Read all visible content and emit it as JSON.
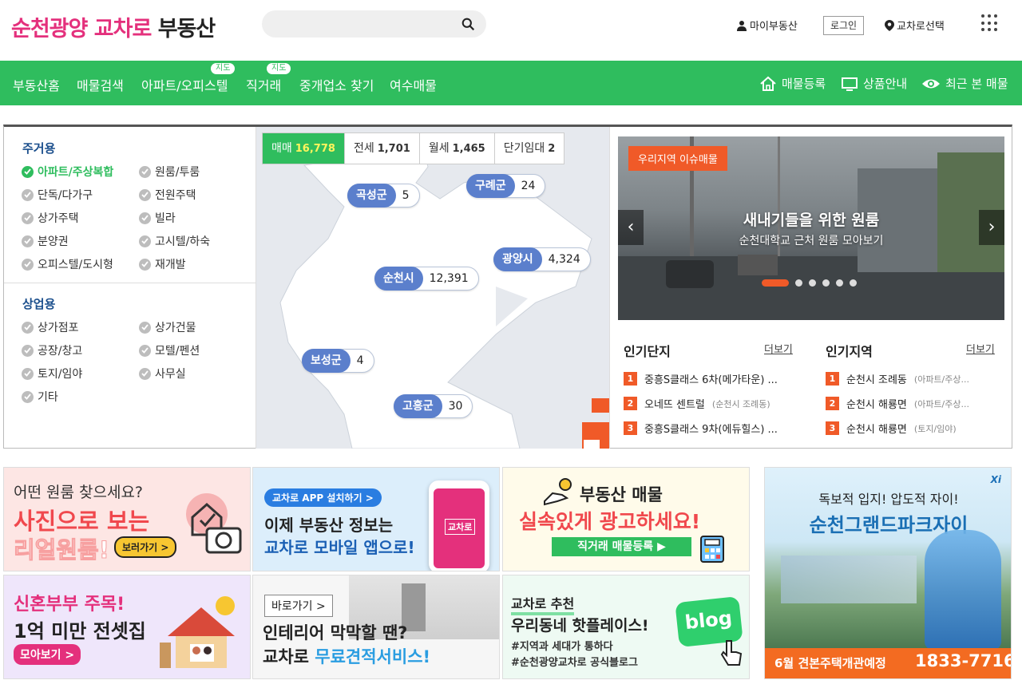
{
  "header": {
    "logo_part1": "순천광양 교차로",
    "logo_part2": "부동산",
    "search_placeholder": "",
    "my_realty": "마이부동산",
    "login": "로그인",
    "region_select": "교차로선택"
  },
  "nav": {
    "items": [
      {
        "label": "부동산홈"
      },
      {
        "label": "매물검색"
      },
      {
        "label": "아파트/오피스텔",
        "badge": "지도"
      },
      {
        "label": "직거래",
        "badge": "지도"
      },
      {
        "label": "중개업소 찾기"
      },
      {
        "label": "여수매물"
      }
    ],
    "right": {
      "register": "매물등록",
      "products": "상품안내",
      "recent": "최근 본 매물"
    }
  },
  "categories": {
    "residential_title": "주거용",
    "residential": [
      "아파트/주상복합",
      "원룸/투룸",
      "단독/다가구",
      "전원주택",
      "상가주택",
      "빌라",
      "분양권",
      "고시텔/하숙",
      "오피스텔/도시형",
      "재개발"
    ],
    "commercial_title": "상업용",
    "commercial": [
      "상가점포",
      "상가건물",
      "공장/창고",
      "모텔/펜션",
      "토지/임야",
      "사무실",
      "기타"
    ]
  },
  "map": {
    "tabs": [
      {
        "label": "매매",
        "count": "16,778"
      },
      {
        "label": "전세",
        "count": "1,701"
      },
      {
        "label": "월세",
        "count": "1,465"
      },
      {
        "label": "단기임대",
        "count": "2"
      }
    ],
    "regions": [
      {
        "name": "곡성군",
        "count": "5"
      },
      {
        "name": "구례군",
        "count": "24"
      },
      {
        "name": "광양시",
        "count": "4,324"
      },
      {
        "name": "순천시",
        "count": "12,391"
      },
      {
        "name": "보성군",
        "count": "4"
      },
      {
        "name": "고흥군",
        "count": "30"
      }
    ]
  },
  "slider": {
    "tag": "우리지역 이슈매물",
    "title": "새내기들을 위한 원룸",
    "subtitle": "순천대학교 근처 원룸 모아보기"
  },
  "popular_complex": {
    "title": "인기단지",
    "more": "더보기",
    "items": [
      {
        "rank": "1",
        "name": "중흥S클래스 6차(메가타운) ...",
        "sub": ""
      },
      {
        "rank": "2",
        "name": "오네뜨 센트럴",
        "sub": "(순천시 조례동)"
      },
      {
        "rank": "3",
        "name": "중흥S클래스 9차(에듀힐스) ...",
        "sub": ""
      }
    ]
  },
  "popular_region": {
    "title": "인기지역",
    "more": "더보기",
    "items": [
      {
        "rank": "1",
        "name": "순천시 조례동",
        "sub": "(아파트/주상..."
      },
      {
        "rank": "2",
        "name": "순천시 해룡면",
        "sub": "(아파트/주상..."
      },
      {
        "rank": "3",
        "name": "순천시 해룡면",
        "sub": "(토지/임야)"
      }
    ]
  },
  "banners": {
    "b1": {
      "line1": "어떤 원룸 찾으세요?",
      "line2": "사진으로 보는",
      "line3": "리얼원룸!",
      "btn": "보러가기 >"
    },
    "b2": {
      "pill": "교차로 APP 설치하기 >",
      "line1": "이제 부동산 정보는",
      "line2": "교차로 모바일 앱으로!",
      "app": "교차로"
    },
    "b3": {
      "line1": "부동산 매물",
      "line2": "실속있게 광고하세요!",
      "btn": "직거래 매물등록 ▶"
    },
    "b4": {
      "line1": "독보적 입지! 압도적 자이!",
      "line2": "순천그랜드파크자이",
      "footer1": "6월 견본주택개관예정",
      "footer2": "1833-7716",
      "brand": "Xi"
    },
    "b5": {
      "line1": "신혼부부 주목!",
      "line2": "1억 미만 전셋집",
      "btn": "모아보기 >"
    },
    "b6": {
      "pill": "바로가기 >",
      "line1": "인테리어 막막할 땐?",
      "line2a": "교차로",
      "line2b": "무료견적서비스!"
    },
    "b7": {
      "line1": "교차로 추천",
      "line2": "우리동네 핫플레이스!",
      "line3": "#지역과 세대가 통하다",
      "line4": "#순천광양교차로 공식블로그",
      "bubble": "blog"
    }
  },
  "colors": {
    "brand_pink": "#e4307c",
    "brand_green": "#2fbd5e",
    "accent_orange": "#f05a28",
    "map_pill_blue": "#5b7fcc"
  }
}
